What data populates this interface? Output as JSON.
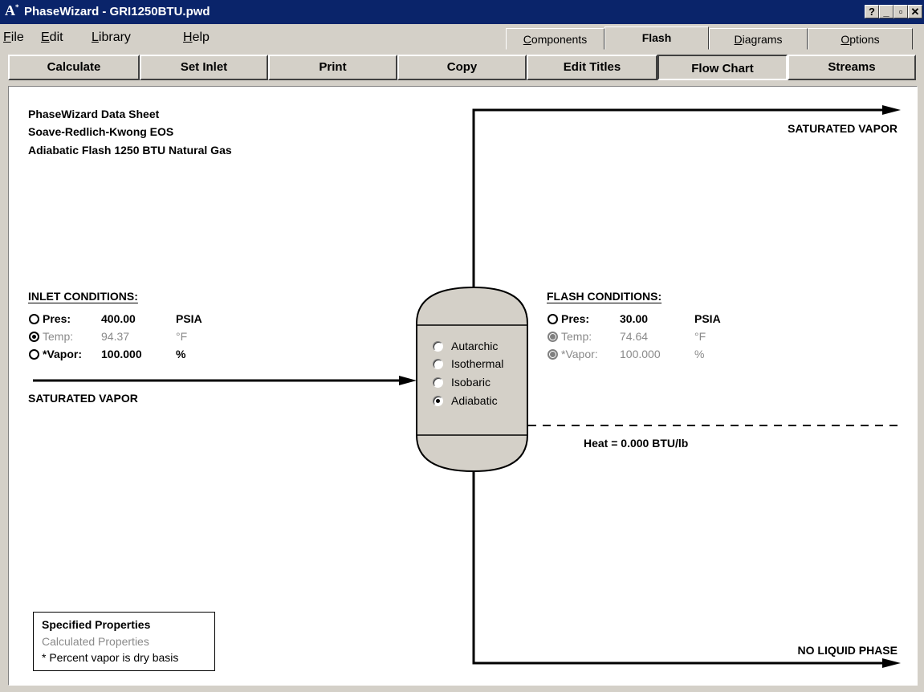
{
  "window": {
    "title": "PhaseWizard - GRI1250BTU.pwd",
    "logo": "A",
    "controls": [
      "?",
      "_",
      "▫",
      "✕"
    ]
  },
  "menu": {
    "file": "File",
    "edit": "Edit",
    "library": "Library",
    "help": "Help"
  },
  "tabs": {
    "components": "Components",
    "flash": "Flash",
    "diagrams": "Diagrams",
    "options": "Options",
    "active": "Flash"
  },
  "toolbar": {
    "calculate": "Calculate",
    "set_inlet": "Set Inlet",
    "print": "Print",
    "copy": "Copy",
    "edit_titles": "Edit Titles",
    "flow_chart": "Flow Chart",
    "streams": "Streams"
  },
  "sheet": {
    "line1": "PhaseWizard Data Sheet",
    "line2": "Soave-Redlich-Kwong EOS",
    "line3": "Adiabatic Flash 1250 BTU Natural Gas"
  },
  "inlet": {
    "header": "INLET CONDITIONS:",
    "pres_label": "Pres:",
    "pres_value": "400.00",
    "pres_unit": "PSIA",
    "temp_label": "Temp:",
    "temp_value": "94.37",
    "temp_unit": "°F",
    "vapor_label": "*Vapor:",
    "vapor_value": "100.000",
    "vapor_unit": "%",
    "stream_label": "SATURATED VAPOR"
  },
  "flash": {
    "header": "FLASH CONDITIONS:",
    "pres_label": "Pres:",
    "pres_value": "30.00",
    "pres_unit": "PSIA",
    "temp_label": "Temp:",
    "temp_value": "74.64",
    "temp_unit": "°F",
    "vapor_label": "*Vapor:",
    "vapor_value": "100.000",
    "vapor_unit": "%",
    "heat_label": "Heat = 0.000 BTU/lb"
  },
  "vessel": {
    "options": [
      "Autarchic",
      "Isothermal",
      "Isobaric",
      "Adiabatic"
    ],
    "selected": "Adiabatic"
  },
  "outlets": {
    "top": "SATURATED VAPOR",
    "bottom": "NO LIQUID PHASE"
  },
  "legend": {
    "specified": "Specified Properties",
    "calculated": "Calculated Properties",
    "note": "* Percent vapor is dry basis"
  }
}
